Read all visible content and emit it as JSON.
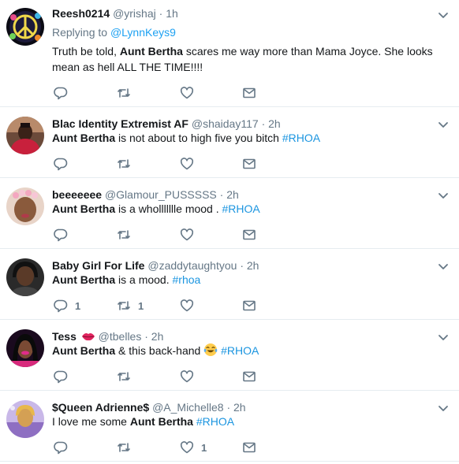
{
  "colors": {
    "accent": "#1da1f2",
    "hashtag": "#1b95e0",
    "muted": "#657786",
    "text": "#14171a",
    "divider": "#e6ecf0"
  },
  "tweets": [
    {
      "name": "Reesh0214",
      "handle": "@yrishaj",
      "time": "1h",
      "replying_prefix": "Replying to",
      "replying_to": "@LynnKeys9",
      "text_before": "Truth be told, ",
      "bold": "Aunt Bertha",
      "text_after": " scares me way more than Mama Joyce. She looks mean as hell ALL THE TIME!!!!",
      "hashtag": "",
      "replies": "",
      "retweets": "",
      "likes": ""
    },
    {
      "name": "Blac Identity Extremist AF",
      "handle": "@shaiday117",
      "time": "2h",
      "bold": "Aunt Bertha",
      "text_after": " is not about to high five you bitch ",
      "hashtag": "#RHOA",
      "replies": "",
      "retweets": "",
      "likes": ""
    },
    {
      "name": "beeeeeee",
      "handle": "@Glamour_PUSSSSS",
      "time": "2h",
      "bold": "Aunt Bertha",
      "text_after": " is a whollllllle mood . ",
      "hashtag": "#RHOA",
      "replies": "",
      "retweets": "",
      "likes": ""
    },
    {
      "name": "Baby Girl For Life",
      "handle": "@zaddytaughtyou",
      "time": "2h",
      "bold": "Aunt Bertha",
      "text_after": " is a mood. ",
      "hashtag": "#rhoa",
      "replies": "1",
      "retweets": "1",
      "likes": ""
    },
    {
      "name": "Tess",
      "handle": "@tbelles",
      "time": "2h",
      "bold": "Aunt Bertha",
      "text_after": " & this back-hand ",
      "hashtag": "#RHOA",
      "name_icon": "kiss-lips-icon",
      "text_icon": "tears-of-joy-emoji-icon",
      "replies": "",
      "retweets": "",
      "likes": ""
    },
    {
      "name": "$Queen Adrienne$",
      "handle": "@A_Michelle8",
      "time": "2h",
      "text_before": "I love me some ",
      "bold": "Aunt Bertha",
      "text_after": " ",
      "hashtag": "#RHOA",
      "replies": "",
      "retweets": "",
      "likes": "1"
    }
  ]
}
